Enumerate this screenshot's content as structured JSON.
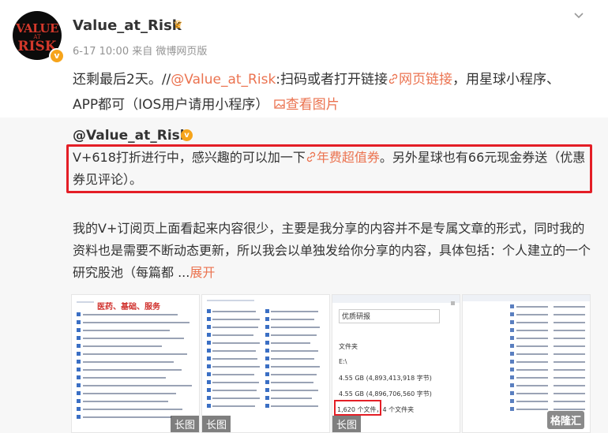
{
  "post": {
    "avatar": {
      "line1": "VALUE",
      "line2": "AT",
      "line3": "RISK"
    },
    "username": "Value_at_Risk",
    "meta": "6-17 10:00  来自 微博网页版",
    "text_prefix": "还剩最后2天。//",
    "mention": "@Value_at_Risk",
    "text_mid": ":扫码或者打开链接",
    "link_label": "网页链接",
    "text_suffix": "，用星球小程序、APP都可（IOS用户请用小程序）",
    "view_image_label": "查看图片"
  },
  "repost": {
    "username": "@Value_at_Risk",
    "highlight_prefix": "V+618打折进行中，感兴趣的可以加一下",
    "highlight_link": "年费超值券",
    "highlight_suffix": "。另外星球也有66元现金券送（优惠券见评论）。",
    "body": "我的V+订阅页上面看起来内容很少，主要是我分享的内容并不是专属文章的形式，同时我的资料也是需要不断动态更新，所以我会以单独发给你分享的内容，具体包括：个人建立的一个研究股池（每篇都 ...",
    "expand_label": "展开"
  },
  "thumbnails": [
    {
      "tag": "长图",
      "title": "医药、基础、服务"
    },
    {
      "tag": "长图"
    },
    {
      "tag": "长图",
      "folder": "优质研报",
      "type_label": "文件夹",
      "drive": "E:\\",
      "size1": "4.55 GB (4,893,413,918 字节)",
      "size2": "4.55 GB (4,896,706,560 字节)",
      "count": "1,620 个文件，4 个文件夹"
    },
    {
      "tag": ""
    }
  ],
  "watermark": "格隆汇",
  "colors": {
    "link": "#eb7350",
    "highlight_border": "#e41e26",
    "badge": "#f6a41b"
  }
}
